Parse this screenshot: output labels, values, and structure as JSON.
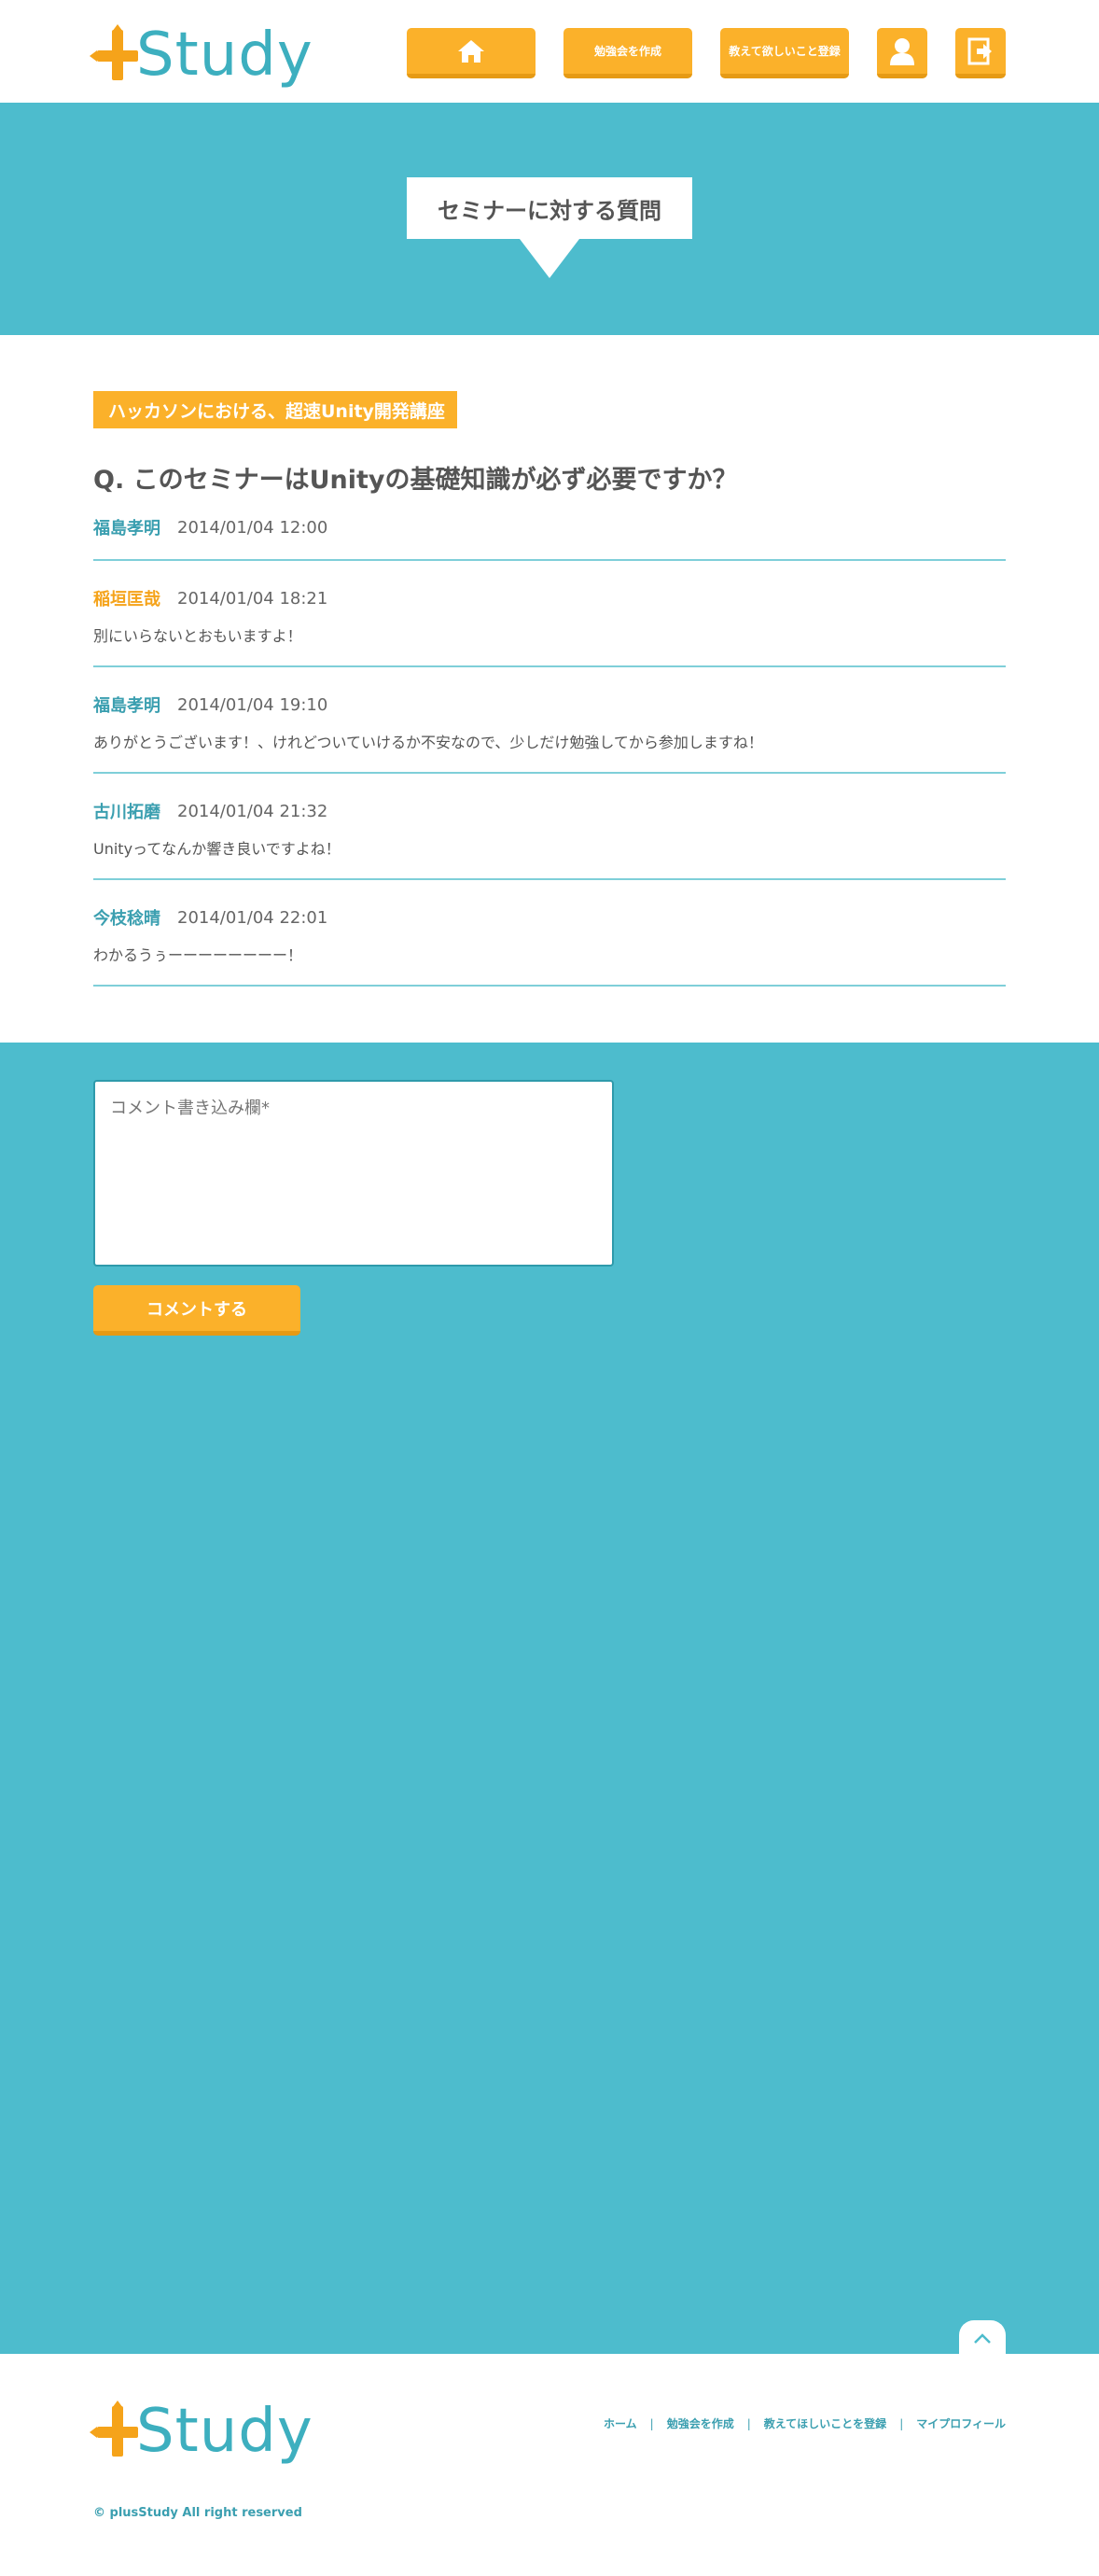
{
  "brand": {
    "name": "Study",
    "symbol": "+"
  },
  "header": {
    "nav": {
      "home_icon": "home-icon",
      "create_study": "勉強会を作成",
      "register_request": "教えて欲しいこと登録",
      "profile_icon": "user-icon",
      "logout_icon": "logout-icon"
    }
  },
  "hero": {
    "title": "セミナーに対する質問"
  },
  "seminar": {
    "title": "ハッカソンにおける、超速Unity開発講座"
  },
  "question": {
    "text": "Q. このセミナーはUnityの基礎知識が必ず必要ですか？",
    "author": "福島孝明",
    "datetime": "2014/01/04 12:00"
  },
  "comments": [
    {
      "author": "稲垣匡哉",
      "datetime": "2014/01/04 18:21",
      "text": "別にいらないとおもいますよ！"
    },
    {
      "author": "福島孝明",
      "datetime": "2014/01/04 19:10",
      "text": "ありがとうございます！、けれどついていけるか不安なので、少しだけ勉強してから参加しますね！"
    },
    {
      "author": "古川拓磨",
      "datetime": "2014/01/04 21:32",
      "text": "Unityってなんか響き良いですよね！"
    },
    {
      "author": "今枝稔晴",
      "datetime": "2014/01/04 22:01",
      "text": "わかるうぅーーーーーーーー！"
    }
  ],
  "form": {
    "placeholder": "コメント書き込み欄*",
    "submit_label": "コメントする"
  },
  "footer": {
    "links": [
      "ホーム",
      "勉強会を作成",
      "教えてほしいことを登録",
      "マイプロフィール"
    ],
    "separator": "|",
    "copyright": "© plusStudy All right reserved"
  },
  "colors": {
    "accent": "#fbb12a",
    "teal": "#4dbccd",
    "link": "#3b9fb0"
  }
}
